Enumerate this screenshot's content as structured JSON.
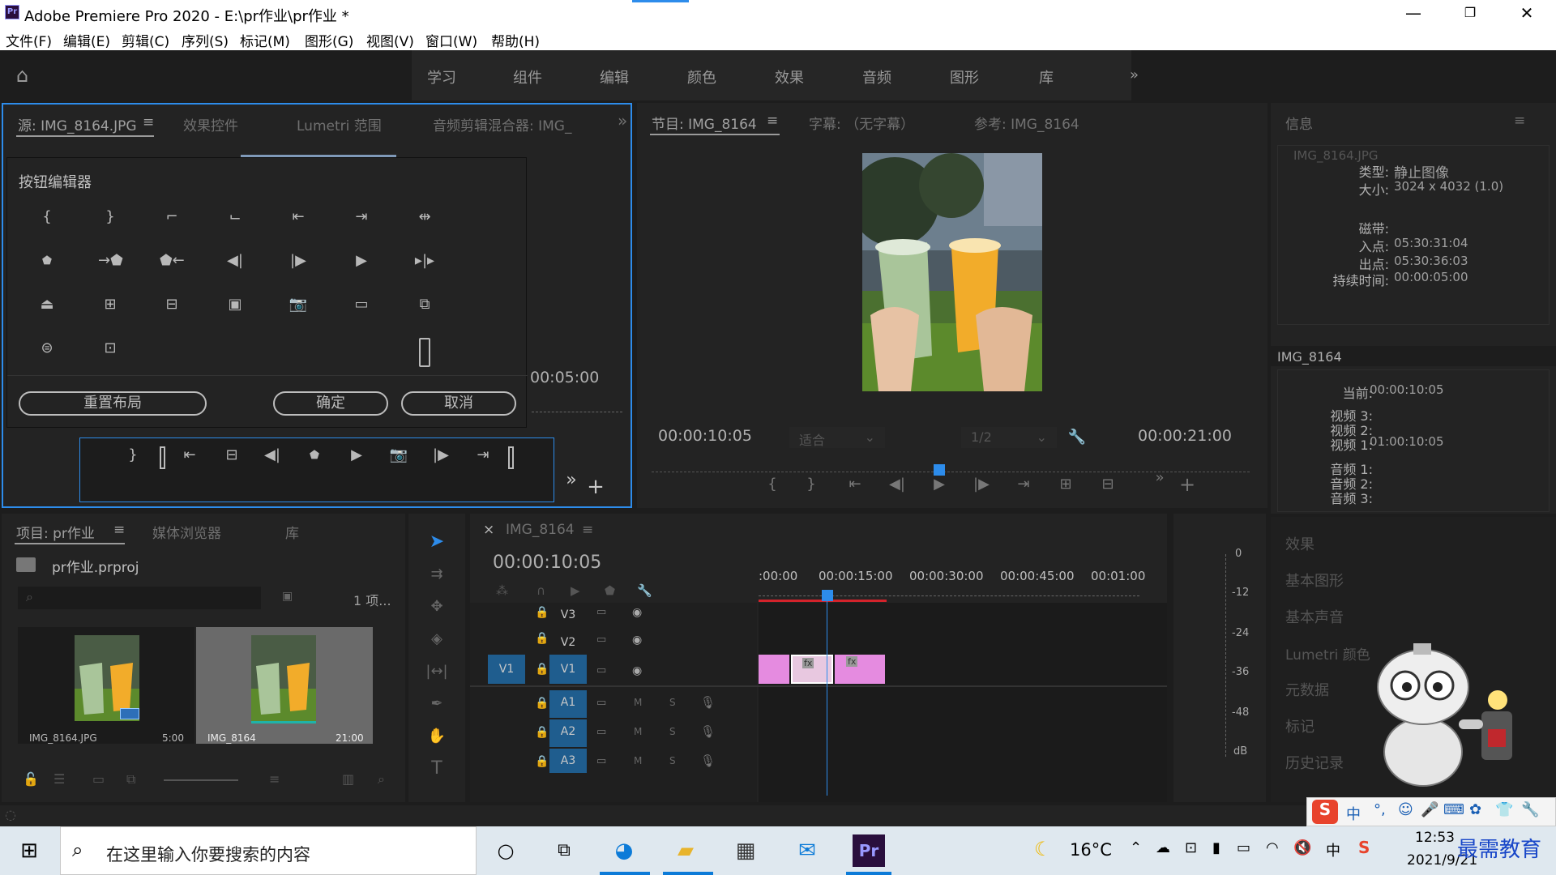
{
  "window": {
    "title": "Adobe Premiere Pro 2020 - E:\\pr作业\\pr作业 *",
    "app_badge": "Pr"
  },
  "menu": [
    "文件(F)",
    "编辑(E)",
    "剪辑(C)",
    "序列(S)",
    "标记(M)",
    "图形(G)",
    "视图(V)",
    "窗口(W)",
    "帮助(H)"
  ],
  "workspaces": [
    "学习",
    "组件",
    "编辑",
    "颜色",
    "效果",
    "音频",
    "图形",
    "库"
  ],
  "source_panel": {
    "tabs": [
      "源: IMG_8164.JPG",
      "效果控件",
      "Lumetri 范围",
      "音频剪辑混合器: IMG_"
    ],
    "timecode_right": "00:05:00"
  },
  "button_editor": {
    "title": "按钮编辑器",
    "reset_label": "重置布局",
    "ok_label": "确定",
    "cancel_label": "取消"
  },
  "program_panel": {
    "tabs": [
      "节目: IMG_8164",
      "字幕: （无字幕）",
      "参考: IMG_8164"
    ],
    "timecode_left": "00:00:10:05",
    "fit_label": "适合",
    "quality_label": "1/2",
    "timecode_right": "00:00:21:00"
  },
  "info_panel": {
    "title": "信息",
    "filename": "IMG_8164.JPG",
    "rows": [
      {
        "label": "类型:",
        "value": "静止图像"
      },
      {
        "label": "大小:",
        "value": "3024 x 4032 (1.0)"
      },
      {
        "label": "磁带:",
        "value": ""
      },
      {
        "label": "入点:",
        "value": "05:30:31:04"
      },
      {
        "label": "出点:",
        "value": "05:30:36:03"
      },
      {
        "label": "持续时间:",
        "value": "00:00:05:00"
      }
    ],
    "seq_name": "IMG_8164",
    "seq_rows": [
      {
        "label": "当前:",
        "value": "00:00:10:05"
      },
      {
        "label": "视频 3:",
        "value": ""
      },
      {
        "label": "视频 2:",
        "value": ""
      },
      {
        "label": "视频 1:",
        "value": "01:00:10:05"
      },
      {
        "label": "音频 1:",
        "value": ""
      },
      {
        "label": "音频 2:",
        "value": ""
      },
      {
        "label": "音频 3:",
        "value": ""
      }
    ]
  },
  "side_links": [
    "效果",
    "基本图形",
    "基本声音",
    "Lumetri 颜色",
    "元数据",
    "标记",
    "历史记录"
  ],
  "project_panel": {
    "tabs": [
      "项目: pr作业",
      "媒体浏览器",
      "库"
    ],
    "project_file": "pr作业.prproj",
    "item_count": "1 项...",
    "items": [
      {
        "name": "IMG_8164.JPG",
        "duration": "5:00"
      },
      {
        "name": "IMG_8164",
        "duration": "21:00"
      }
    ]
  },
  "timeline": {
    "tab": "IMG_8164",
    "timecode": "00:00:10:05",
    "ruler": [
      ":00:00",
      "00:00:15:00",
      "00:00:30:00",
      "00:00:45:00",
      "00:01:00"
    ],
    "video_tracks": [
      "V3",
      "V2",
      "V1"
    ],
    "audio_tracks": [
      "A1",
      "A2",
      "A3"
    ],
    "source_patch": "V1",
    "clip_badge": "fx",
    "mute": "M",
    "solo": "S"
  },
  "meter": {
    "ticks": [
      "0",
      "-12",
      "-24",
      "-36",
      "-48",
      "dB"
    ]
  },
  "taskbar": {
    "search_placeholder": "在这里输入你要搜索的内容",
    "weather": "16°C",
    "ime": "中",
    "time": "12:53",
    "date": "2021/9/21",
    "watermark": "最需教育"
  },
  "colors": {
    "accent_blue": "#2d8ceb",
    "clip_pink": "#e58be0",
    "track_blue": "#1f5d8e"
  }
}
